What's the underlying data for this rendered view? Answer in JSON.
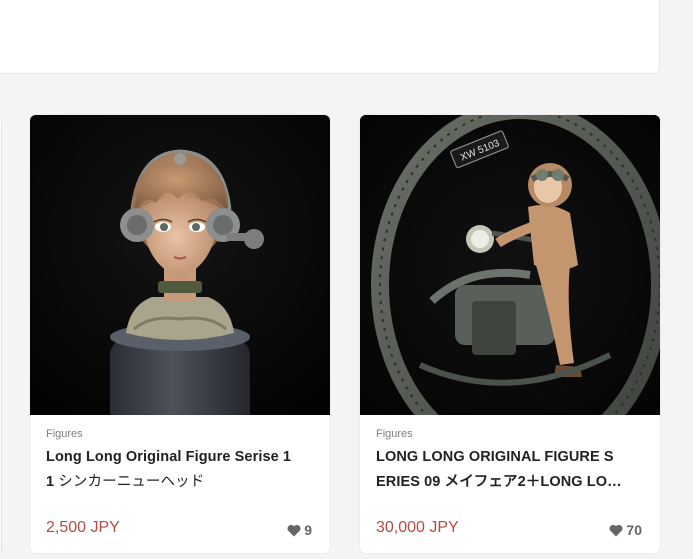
{
  "listings": [
    {
      "category": "Figures",
      "title_line1": "Long Long Original Figure Serise 1",
      "title_line2_prefix": "1 ",
      "title_line2_jp": "シンカーニューヘッド",
      "price": "2,500 JPY",
      "likes": "9",
      "image_icon": "figure-bust-photo"
    },
    {
      "category": "Figures",
      "title_line1": "LONG LONG ORIGINAL FIGURE S",
      "title_line2_prefix": "ERIES 09 ",
      "title_line2_jp": "メイフェア2＋LONG LO…",
      "price": "30,000 JPY",
      "likes": "70",
      "image_icon": "monowheel-figure-photo",
      "plate_text": "XW 5103"
    }
  ],
  "colors": {
    "price": "#b84a44",
    "like": "#666666",
    "background": "#f4f4f4"
  }
}
